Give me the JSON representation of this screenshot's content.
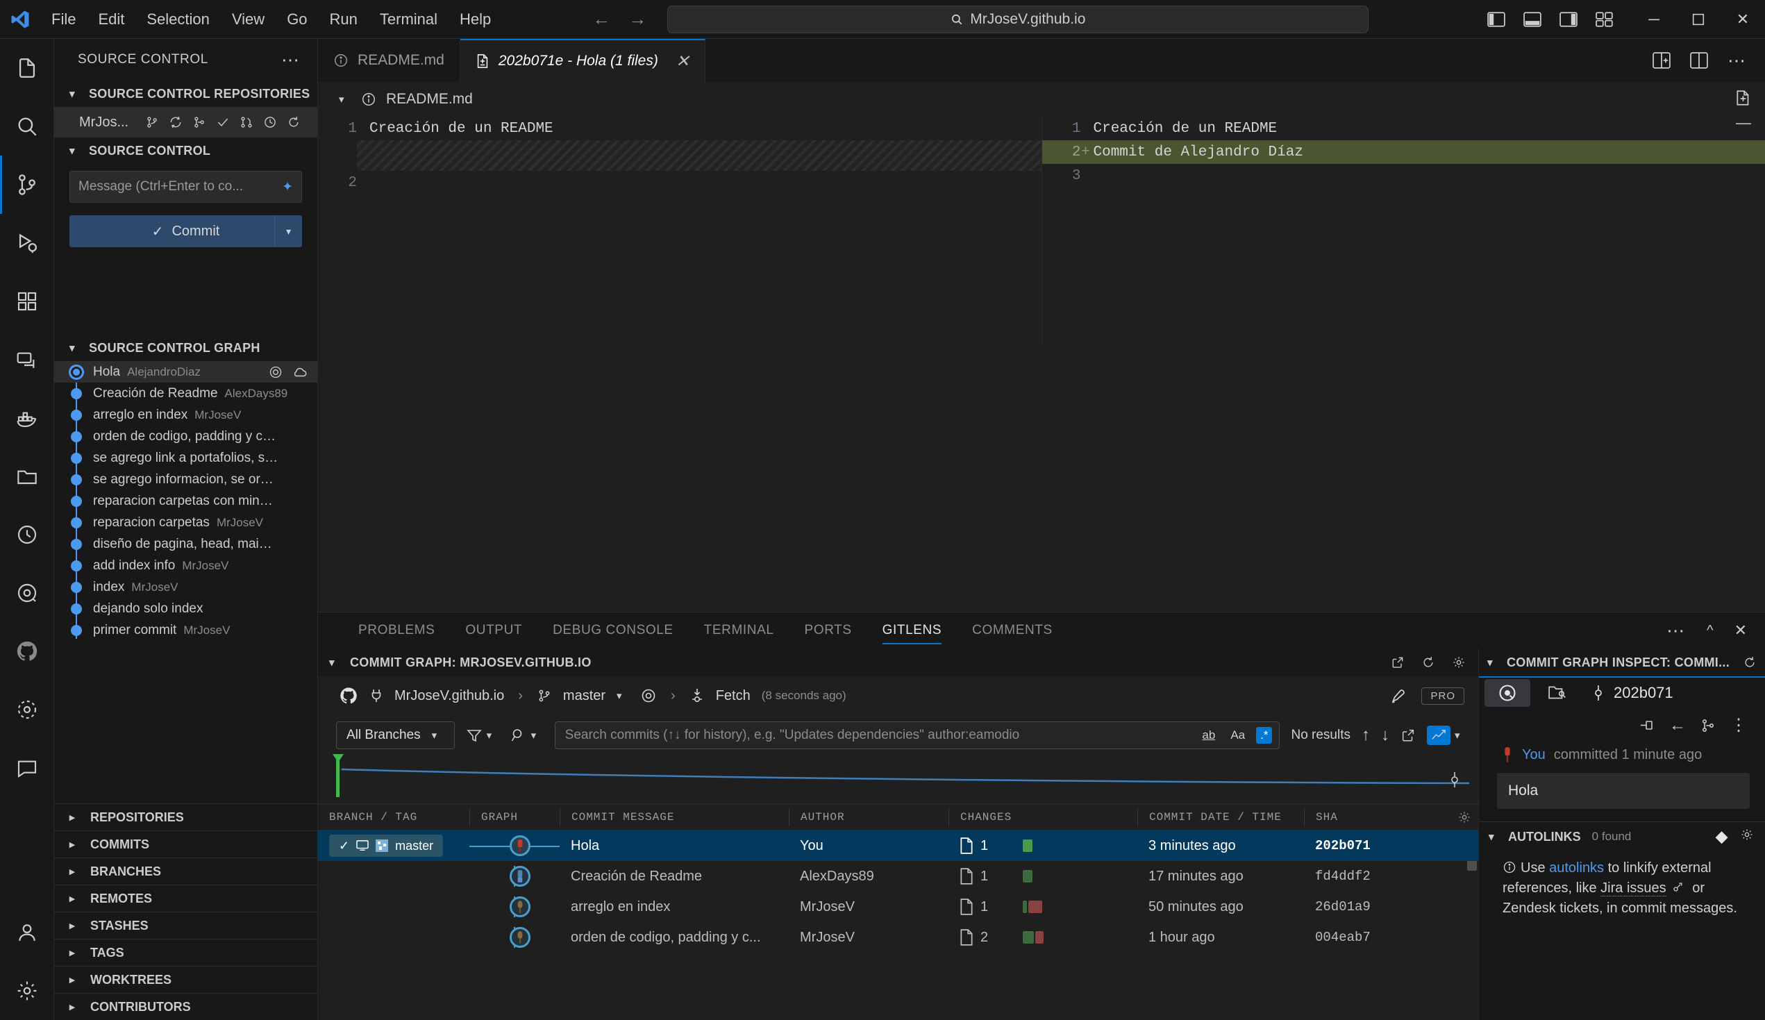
{
  "titlebar": {
    "logo_icon": "vscode-logo-icon",
    "menu": [
      "File",
      "Edit",
      "Selection",
      "View",
      "Go",
      "Run",
      "Terminal",
      "Help"
    ],
    "back_icon": "arrow-left-icon",
    "forward_icon": "arrow-right-icon",
    "command_center": {
      "text": "MrJoseV.github.io",
      "icon": "search-icon"
    },
    "layout_icons": [
      "toggle-primary-sidebar-icon",
      "toggle-panel-icon",
      "toggle-secondary-sidebar-icon",
      "customize-layout-icon"
    ],
    "window_buttons": [
      "minimize-icon",
      "maximize-icon",
      "close-icon"
    ]
  },
  "activitybar": {
    "items": [
      {
        "name": "explorer-icon"
      },
      {
        "name": "search-icon"
      },
      {
        "name": "source-control-icon",
        "active": true
      },
      {
        "name": "run-and-debug-icon"
      },
      {
        "name": "extensions-icon"
      },
      {
        "name": "remote-explorer-icon"
      },
      {
        "name": "docker-icon"
      },
      {
        "name": "folder-icon"
      },
      {
        "name": "gitlens-inspect-icon"
      },
      {
        "name": "gitlens-icon"
      },
      {
        "name": "github-icon"
      },
      {
        "name": "settings-gear-circle-icon"
      },
      {
        "name": "chat-icon"
      }
    ],
    "bottom": [
      {
        "name": "accounts-icon"
      },
      {
        "name": "manage-settings-gear-icon"
      }
    ]
  },
  "sidebar": {
    "title": "SOURCE CONTROL",
    "title_more_icon": "more-actions-icon",
    "repositories_section": {
      "label": "SOURCE CONTROL REPOSITORIES",
      "repo_name": "MrJos...",
      "icons": [
        "branch-icon",
        "sync-icon",
        "checkout-icon",
        "check-icon",
        "pull-request-icon",
        "history-icon",
        "refresh-icon"
      ]
    },
    "source_control_section": {
      "label": "SOURCE CONTROL",
      "message_placeholder": "Message (Ctrl+Enter to co...",
      "sparkle_icon": "generate-commit-message-icon",
      "commit_label": "Commit",
      "commit_check_icon": "check-icon",
      "commit_dropdown_icon": "chevron-down-icon"
    },
    "graph_section": {
      "label": "SOURCE CONTROL GRAPH",
      "commits": [
        {
          "message": "Hola",
          "author": "AlejandroDiaz",
          "selected": true,
          "icons": [
            "target-icon",
            "cloud-icon"
          ]
        },
        {
          "message": "Creación de Readme",
          "author": "AlexDays89"
        },
        {
          "message": "arreglo en index",
          "author": "MrJoseV"
        },
        {
          "message": "orden de codigo, padding y ca...",
          "author": ""
        },
        {
          "message": "se agrego link a portafolios, se a...",
          "author": ""
        },
        {
          "message": "se agrego informacion, se orden...",
          "author": ""
        },
        {
          "message": "reparacion carpetas con minusc...",
          "author": ""
        },
        {
          "message": "reparacion carpetas",
          "author": "MrJoseV"
        },
        {
          "message": "diseño de pagina, head, main, fo...",
          "author": ""
        },
        {
          "message": "add index info",
          "author": "MrJoseV"
        },
        {
          "message": "index",
          "author": "MrJoseV"
        },
        {
          "message": "dejando solo index",
          "author": ""
        },
        {
          "message": "primer commit",
          "author": "MrJoseV"
        }
      ]
    },
    "collapsed_sections": [
      "REPOSITORIES",
      "COMMITS",
      "BRANCHES",
      "REMOTES",
      "STASHES",
      "TAGS",
      "WORKTREES",
      "CONTRIBUTORS"
    ]
  },
  "editor": {
    "tabs": [
      {
        "label": "README.md",
        "icon": "info-circle-icon",
        "active": false
      },
      {
        "label": "202b071e - Hola (1 files)",
        "icon": "file-diff-icon",
        "active": true,
        "close_icon": "close-icon"
      }
    ],
    "tabbar_actions": [
      "split-editor-right-icon",
      "split-editor-icon",
      "more-actions-icon"
    ],
    "diff_header": {
      "label": "README.md",
      "chevron": "chevron-down-icon",
      "icon": "info-circle-icon"
    },
    "left_pane": {
      "lines": [
        {
          "num": "1",
          "text": "Creación de un README",
          "type": "context"
        },
        {
          "num": "",
          "text": "",
          "type": "filler"
        },
        {
          "num": "2",
          "text": "",
          "type": "context"
        }
      ]
    },
    "right_pane": {
      "lines": [
        {
          "num": "1",
          "sign": "",
          "text": "Creación de un README",
          "type": "context"
        },
        {
          "num": "2",
          "sign": "+",
          "text": "Commit de Alejandro Díaz",
          "type": "added"
        },
        {
          "num": "3",
          "sign": "",
          "text": "",
          "type": "context"
        }
      ]
    },
    "actions": [
      "open-changes-icon",
      "collapse-icon"
    ]
  },
  "panel": {
    "tabs": [
      "PROBLEMS",
      "OUTPUT",
      "DEBUG CONSOLE",
      "TERMINAL",
      "PORTS",
      "GITLENS",
      "COMMENTS"
    ],
    "active_tab": "GITLENS",
    "actions": [
      "more-actions-icon",
      "maximize-panel-icon",
      "close-panel-icon"
    ]
  },
  "commit_graph": {
    "view_title": "COMMIT GRAPH: MRJOSEV.GITHUB.IO",
    "title_icons": [
      "open-in-editor-icon",
      "refresh-icon",
      "settings-gear-icon"
    ],
    "breadcrumb": {
      "provider_icon": "github-icon",
      "plug_icon": "plug-icon",
      "repo": "MrJoseV.github.io",
      "branch_icon": "branch-icon",
      "branch": "master",
      "branch_chevron": "chevron-down-icon",
      "target_icon": "target-icon",
      "fetch_icon": "fetch-icon",
      "fetch_label": "Fetch",
      "fetch_time": "(8 seconds ago)",
      "right_icons": [
        "launchpad-icon"
      ],
      "pro_badge": "PRO"
    },
    "toolbar": {
      "branches_filter": "All Branches",
      "branches_chevron": "chevron-down-icon",
      "filter_icon": "filter-icon",
      "search_icon": "search-icon",
      "search_placeholder": "Search commits (↑↓ for history), e.g. \"Updates dependencies\" author:eamodio",
      "match_whole_word": "ab",
      "match_case": "Aa",
      "use_regex": ".*",
      "results_text": "No results",
      "prev_icon": "arrow-up-icon",
      "next_icon": "arrow-down-icon",
      "open_icon": "open-in-new-icon",
      "graph_toggle_icon": "minimap-chart-icon",
      "graph_toggle_chevron": "chevron-down-icon"
    },
    "columns": [
      "BRANCH / TAG",
      "GRAPH",
      "COMMIT MESSAGE",
      "AUTHOR",
      "CHANGES",
      "COMMIT DATE / TIME",
      "SHA"
    ],
    "settings_icon": "settings-gear-icon",
    "rows": [
      {
        "branch": "master",
        "branch_icons": [
          "check-icon",
          "local-icon",
          "avatar-icon"
        ],
        "message": "Hola",
        "author": "You",
        "files": "1",
        "bars": [
          {
            "color": "#4a9c4a",
            "width": 14
          }
        ],
        "date": "3 minutes ago",
        "sha": "202b071",
        "selected": true
      },
      {
        "branch": "",
        "branch_icons": [],
        "message": "Creación de Readme",
        "author": "AlexDays89",
        "files": "1",
        "bars": [
          {
            "color": "#3e6b3e",
            "width": 14
          }
        ],
        "date": "17 minutes ago",
        "sha": "fd4ddf2",
        "selected": false
      },
      {
        "branch": "",
        "branch_icons": [],
        "message": "arreglo en index",
        "author": "MrJoseV",
        "files": "1",
        "bars": [
          {
            "color": "#3e6b3e",
            "width": 6
          },
          {
            "color": "#8a4141",
            "width": 20
          }
        ],
        "date": "50 minutes ago",
        "sha": "26d01a9",
        "selected": false
      },
      {
        "branch": "",
        "branch_icons": [],
        "message": "orden de codigo, padding y c...",
        "author": "MrJoseV",
        "files": "2",
        "bars": [
          {
            "color": "#3e6b3e",
            "width": 16
          },
          {
            "color": "#8a4141",
            "width": 12
          }
        ],
        "date": "1 hour ago",
        "sha": "004eab7",
        "selected": false
      }
    ]
  },
  "inspect": {
    "title": "COMMIT GRAPH INSPECT: COMMI...",
    "title_icon": "refresh-icon",
    "tabs": [
      {
        "name": "inspect-tab",
        "icon": "search-circle-icon",
        "active": true
      },
      {
        "name": "commit-details-tab",
        "icon": "folder-search-icon",
        "active": false
      }
    ],
    "sha": "202b071",
    "sha_icon": "commit-node-icon",
    "actions": [
      "pin-icon",
      "back-icon",
      "compare-icon",
      "more-actions-icon"
    ],
    "author_icon": "avatar-icon",
    "author": "You",
    "committed_text": "committed 1 minute ago",
    "message": "Hola",
    "autolinks": {
      "label": "AUTOLINKS",
      "count": "0 found",
      "icons": [
        "integration-icon",
        "settings-gear-icon"
      ],
      "info_icon": "info-circle-icon",
      "text_parts": [
        "Use ",
        "autolinks",
        " to linkify external references, like ",
        "Jira issues",
        " or Zendesk tickets, in commit messages."
      ]
    }
  },
  "colors": {
    "accent": "#0078d4",
    "graph_blue": "#4e9af1",
    "added_green": "#4a5632",
    "selection_blue": "#04395e",
    "branch_chip": "#2b5566"
  }
}
